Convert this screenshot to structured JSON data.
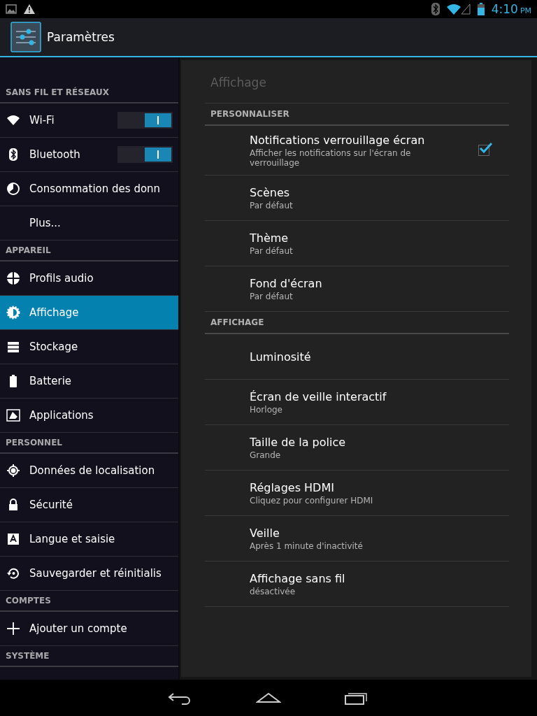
{
  "status_bar": {
    "time": "4:10",
    "ampm": "PM"
  },
  "action_bar": {
    "title": "Paramètres"
  },
  "sidebar": [
    {
      "kind": "header",
      "label": "SANS FIL ET RÉSEAUX"
    },
    {
      "kind": "item",
      "label": "Wi-Fi",
      "toggle": true,
      "selected": false
    },
    {
      "kind": "item",
      "label": "Bluetooth",
      "toggle": true,
      "selected": false
    },
    {
      "kind": "item",
      "label": "Consommation des donn",
      "selected": false
    },
    {
      "kind": "item",
      "label": "Plus...",
      "selected": false
    },
    {
      "kind": "header",
      "label": "APPAREIL"
    },
    {
      "kind": "item",
      "label": "Profils audio",
      "selected": false
    },
    {
      "kind": "item",
      "label": "Affichage",
      "selected": true
    },
    {
      "kind": "item",
      "label": "Stockage",
      "selected": false
    },
    {
      "kind": "item",
      "label": "Batterie",
      "selected": false
    },
    {
      "kind": "item",
      "label": "Applications",
      "selected": false
    },
    {
      "kind": "header",
      "label": "PERSONNEL"
    },
    {
      "kind": "item",
      "label": "Données de localisation",
      "selected": false
    },
    {
      "kind": "item",
      "label": "Sécurité",
      "selected": false
    },
    {
      "kind": "item",
      "label": "Langue et saisie",
      "selected": false
    },
    {
      "kind": "item",
      "label": "Sauvegarder et réinitialis",
      "selected": false
    },
    {
      "kind": "header",
      "label": "COMPTES"
    },
    {
      "kind": "item",
      "label": "Ajouter un compte",
      "selected": false
    },
    {
      "kind": "header",
      "label": "SYSTÈME"
    }
  ],
  "detail": {
    "title": "Affichage",
    "sections": [
      {
        "header": "PERSONNALISER",
        "items": [
          {
            "title": "Notifications verrouillage écran",
            "summary": "Afficher les notifications sur l'écran de verrouillage",
            "checked": true
          },
          {
            "title": "Scènes",
            "summary": "Par défaut"
          },
          {
            "title": "Thème",
            "summary": "Par défaut"
          },
          {
            "title": "Fond d'écran",
            "summary": "Par défaut"
          }
        ]
      },
      {
        "header": "AFFICHAGE",
        "items": [
          {
            "title": "Luminosité"
          },
          {
            "title": "Écran de veille interactif",
            "summary": "Horloge"
          },
          {
            "title": "Taille de la police",
            "summary": "Grande"
          },
          {
            "title": "Réglages HDMI",
            "summary": "Cliquez pour configurer HDMI"
          },
          {
            "title": "Veille",
            "summary": "Après 1 minute d'inactivité"
          },
          {
            "title": "Affichage sans fil",
            "summary": "désactivée"
          }
        ]
      }
    ]
  }
}
